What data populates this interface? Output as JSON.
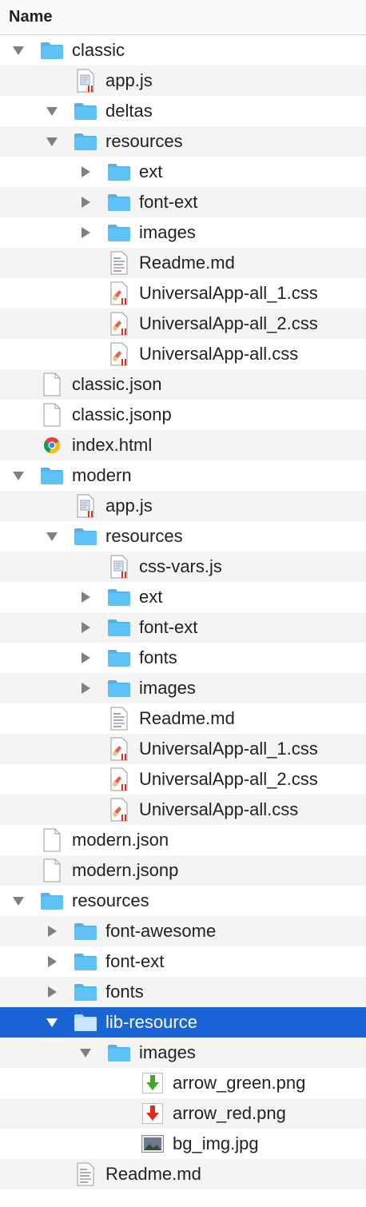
{
  "header": {
    "name_label": "Name"
  },
  "colors": {
    "selection": "#1a64d6",
    "folder": "#5fc2f6",
    "arrow_green": "#43a52c",
    "arrow_red": "#e0291f"
  },
  "rows": [
    {
      "label": "classic",
      "icon": "folder-icon",
      "toggle": "expanded",
      "depth": 0
    },
    {
      "label": "app.js",
      "icon": "script-file-icon",
      "toggle": "none",
      "depth": 1
    },
    {
      "label": "deltas",
      "icon": "folder-icon",
      "toggle": "expanded",
      "depth": 1
    },
    {
      "label": "resources",
      "icon": "folder-icon",
      "toggle": "expanded",
      "depth": 1
    },
    {
      "label": "ext",
      "icon": "folder-icon",
      "toggle": "collapsed",
      "depth": 2
    },
    {
      "label": "font-ext",
      "icon": "folder-icon",
      "toggle": "collapsed",
      "depth": 2
    },
    {
      "label": "images",
      "icon": "folder-icon",
      "toggle": "collapsed",
      "depth": 2
    },
    {
      "label": "Readme.md",
      "icon": "text-file-icon",
      "toggle": "none",
      "depth": 2
    },
    {
      "label": "UniversalApp-all_1.css",
      "icon": "css-file-icon",
      "toggle": "none",
      "depth": 2
    },
    {
      "label": "UniversalApp-all_2.css",
      "icon": "css-file-icon",
      "toggle": "none",
      "depth": 2
    },
    {
      "label": "UniversalApp-all.css",
      "icon": "css-file-icon",
      "toggle": "none",
      "depth": 2
    },
    {
      "label": "classic.json",
      "icon": "blank-file-icon",
      "toggle": "none",
      "depth": 0
    },
    {
      "label": "classic.jsonp",
      "icon": "blank-file-icon",
      "toggle": "none",
      "depth": 0
    },
    {
      "label": "index.html",
      "icon": "chrome-html-icon",
      "toggle": "none",
      "depth": 0
    },
    {
      "label": "modern",
      "icon": "folder-icon",
      "toggle": "expanded",
      "depth": 0
    },
    {
      "label": "app.js",
      "icon": "script-file-icon",
      "toggle": "none",
      "depth": 1
    },
    {
      "label": "resources",
      "icon": "folder-icon",
      "toggle": "expanded",
      "depth": 1
    },
    {
      "label": "css-vars.js",
      "icon": "script-file-icon",
      "toggle": "none",
      "depth": 2
    },
    {
      "label": "ext",
      "icon": "folder-icon",
      "toggle": "collapsed",
      "depth": 2
    },
    {
      "label": "font-ext",
      "icon": "folder-icon",
      "toggle": "collapsed",
      "depth": 2
    },
    {
      "label": "fonts",
      "icon": "folder-icon",
      "toggle": "collapsed",
      "depth": 2
    },
    {
      "label": "images",
      "icon": "folder-icon",
      "toggle": "collapsed",
      "depth": 2
    },
    {
      "label": "Readme.md",
      "icon": "text-file-icon",
      "toggle": "none",
      "depth": 2
    },
    {
      "label": "UniversalApp-all_1.css",
      "icon": "css-file-icon",
      "toggle": "none",
      "depth": 2
    },
    {
      "label": "UniversalApp-all_2.css",
      "icon": "css-file-icon",
      "toggle": "none",
      "depth": 2
    },
    {
      "label": "UniversalApp-all.css",
      "icon": "css-file-icon",
      "toggle": "none",
      "depth": 2
    },
    {
      "label": "modern.json",
      "icon": "blank-file-icon",
      "toggle": "none",
      "depth": 0
    },
    {
      "label": "modern.jsonp",
      "icon": "blank-file-icon",
      "toggle": "none",
      "depth": 0
    },
    {
      "label": "resources",
      "icon": "folder-icon",
      "toggle": "expanded",
      "depth": 0
    },
    {
      "label": "font-awesome",
      "icon": "folder-icon",
      "toggle": "collapsed",
      "depth": 1
    },
    {
      "label": "font-ext",
      "icon": "folder-icon",
      "toggle": "collapsed",
      "depth": 1
    },
    {
      "label": "fonts",
      "icon": "folder-icon",
      "toggle": "collapsed",
      "depth": 1
    },
    {
      "label": "lib-resource",
      "icon": "folder-icon",
      "toggle": "expanded",
      "depth": 1,
      "selected": true
    },
    {
      "label": "images",
      "icon": "folder-icon",
      "toggle": "expanded",
      "depth": 2
    },
    {
      "label": "arrow_green.png",
      "icon": "green-down-arrow-icon",
      "toggle": "none",
      "depth": 3
    },
    {
      "label": "arrow_red.png",
      "icon": "red-down-arrow-icon",
      "toggle": "none",
      "depth": 3
    },
    {
      "label": "bg_img.jpg",
      "icon": "image-file-icon",
      "toggle": "none",
      "depth": 3
    },
    {
      "label": "Readme.md",
      "icon": "text-file-icon",
      "toggle": "none",
      "depth": 1
    }
  ]
}
